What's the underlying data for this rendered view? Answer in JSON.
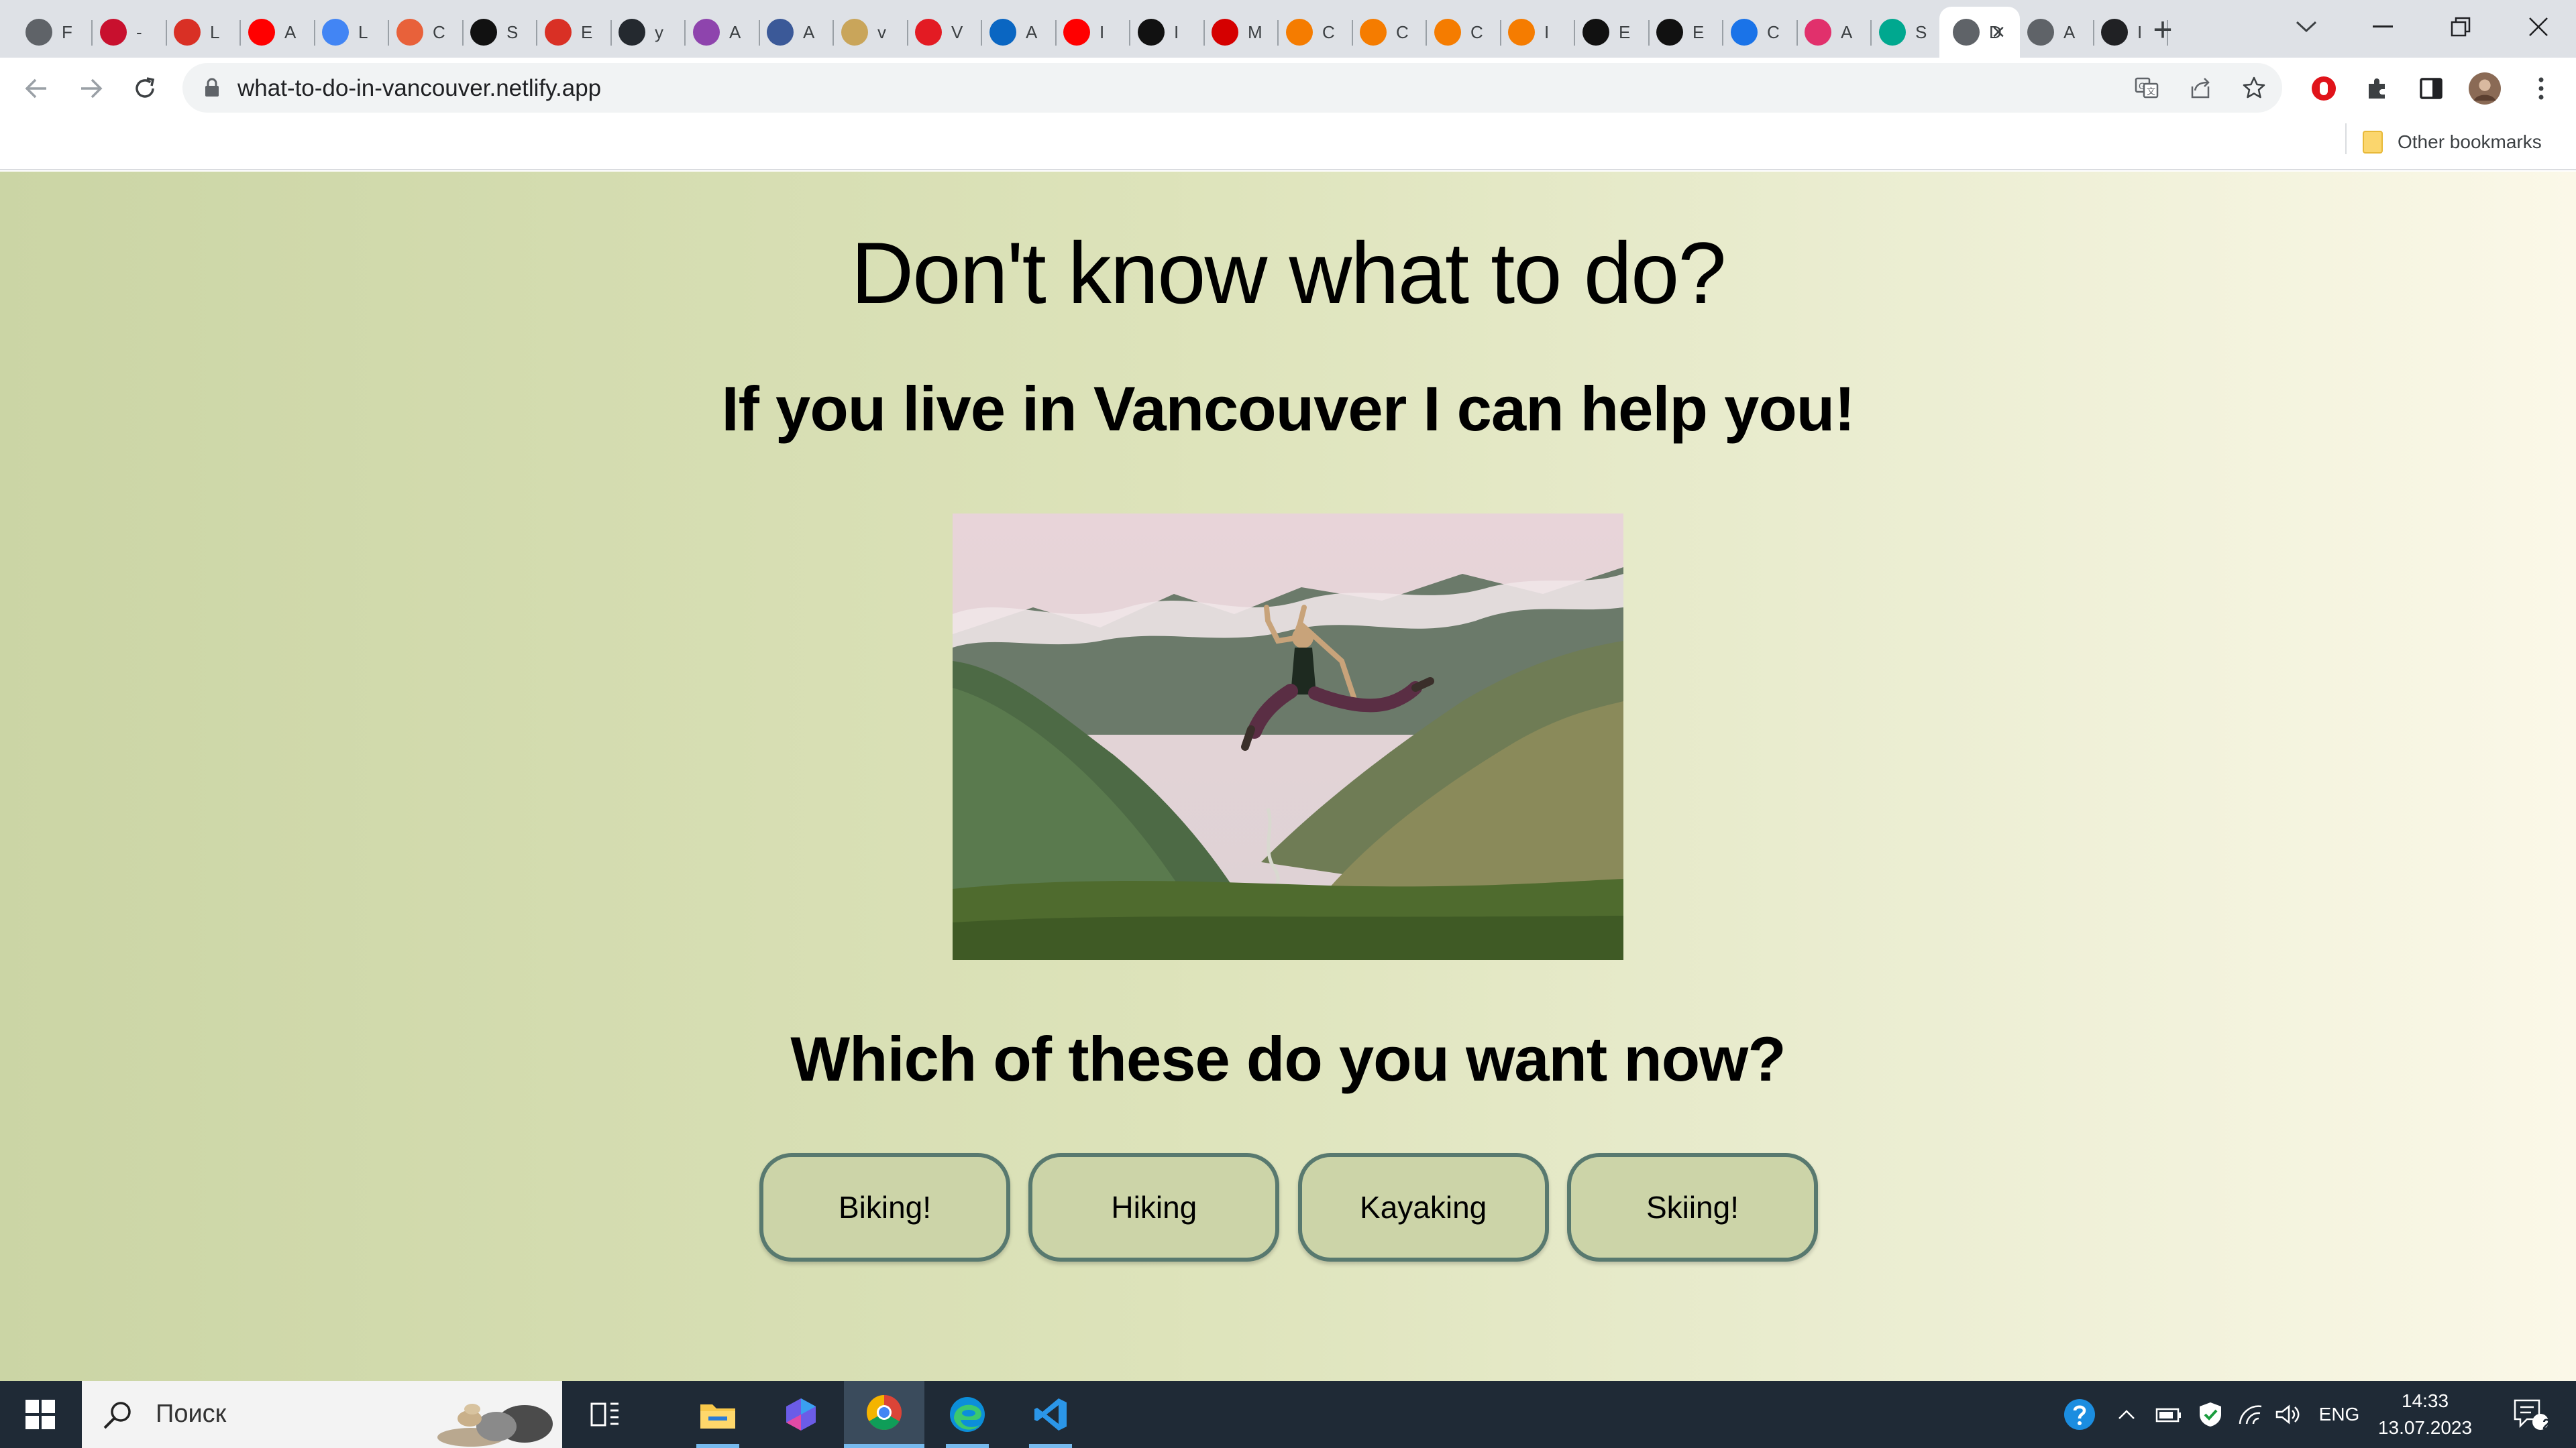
{
  "browser": {
    "tabs": [
      {
        "icon": "globe-icon",
        "title": "F",
        "color": "#5f6368"
      },
      {
        "icon": "mcafee-like-icon",
        "title": "-",
        "color": "#c8102e"
      },
      {
        "icon": "person-red-icon",
        "title": "L",
        "color": "#d93025"
      },
      {
        "icon": "youtube-icon",
        "title": "A",
        "color": "#ff0000"
      },
      {
        "icon": "colorful-app-icon",
        "title": "L",
        "color": "#4285f4"
      },
      {
        "icon": "hand-icon",
        "title": "C",
        "color": "#e8613a"
      },
      {
        "icon": "m-logo-icon",
        "title": "S",
        "color": "#111111"
      },
      {
        "icon": "person-red-icon",
        "title": "E",
        "color": "#d93025"
      },
      {
        "icon": "github-icon",
        "title": "y",
        "color": "#24292f"
      },
      {
        "icon": "flower-icon",
        "title": "A",
        "color": "#8e44ad"
      },
      {
        "icon": "s-blue-icon",
        "title": "A",
        "color": "#3b5998"
      },
      {
        "icon": "doge-icon",
        "title": "v",
        "color": "#c9a55a"
      },
      {
        "icon": "v-red-icon",
        "title": "V",
        "color": "#e31b23"
      },
      {
        "icon": "linkedin-icon",
        "title": "A",
        "color": "#0a66c2"
      },
      {
        "icon": "youtube-icon",
        "title": "I",
        "color": "#ff0000"
      },
      {
        "icon": "music-note-icon",
        "title": "I",
        "color": "#111111"
      },
      {
        "icon": "m-red-icon",
        "title": "M",
        "color": "#d50000"
      },
      {
        "icon": "e-orange-icon",
        "title": "C",
        "color": "#f57c00"
      },
      {
        "icon": "e-orange-icon",
        "title": "C",
        "color": "#f57c00"
      },
      {
        "icon": "e-orange-icon",
        "title": "C",
        "color": "#f57c00"
      },
      {
        "icon": "e-orange-icon",
        "title": "I",
        "color": "#f57c00"
      },
      {
        "icon": "a-serif-icon",
        "title": "E",
        "color": "#111111"
      },
      {
        "icon": "a-serif-icon",
        "title": "E",
        "color": "#111111"
      },
      {
        "icon": "globe-blue-icon",
        "title": "C",
        "color": "#1a73e8"
      },
      {
        "icon": "instagram-icon",
        "title": "A",
        "color": "#e1306c"
      },
      {
        "icon": "diamond-icon",
        "title": "S",
        "color": "#00a88f"
      },
      {
        "icon": "document-icon",
        "title": "D",
        "color": "#5f6368",
        "active": true
      },
      {
        "icon": "globe-icon",
        "title": "A",
        "color": "#5f6368"
      },
      {
        "icon": "book-icon",
        "title": "I",
        "color": "#202124"
      }
    ],
    "new_tab_label": "+",
    "url": "what-to-do-in-vancouver.netlify.app",
    "bookmarks_other": "Other bookmarks"
  },
  "page": {
    "heading": "Don't know what to do?",
    "subheading": "If you live in Vancouver I can help you!",
    "hero_image_alt": "Person jumping in front of green mountains",
    "question": "Which of these do you want now?",
    "choices": [
      "Biking!",
      "Hiking",
      "Kayaking",
      "Skiing!"
    ]
  },
  "taskbar": {
    "search_placeholder": "Поиск",
    "language": "ENG",
    "time": "14:33",
    "date": "13.07.2023",
    "notification_count": "2"
  },
  "colors": {
    "button_bg": "#ccd4a8",
    "button_border": "#58796f",
    "page_gradient_start": "#cbd5a5",
    "page_gradient_end": "#fbf8e8"
  }
}
